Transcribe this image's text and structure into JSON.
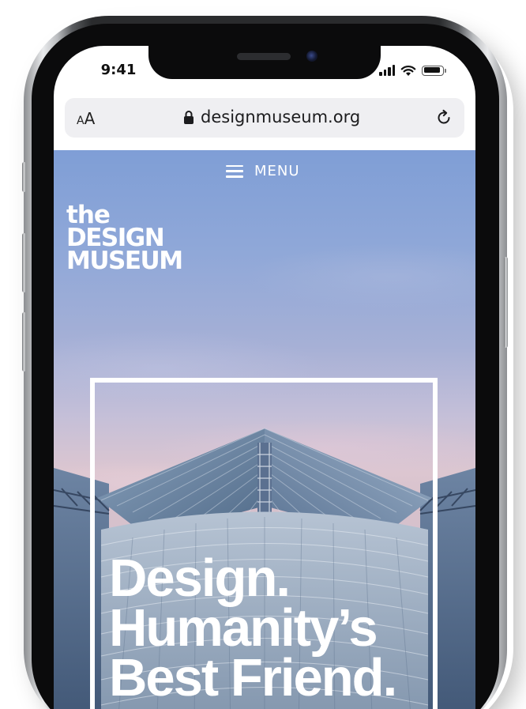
{
  "status_bar": {
    "time": "9:41",
    "icons": [
      "signal-icon",
      "wifi-icon",
      "battery-icon"
    ]
  },
  "browser": {
    "text_size_small": "A",
    "text_size_big": "A",
    "url": "designmuseum.org",
    "lock_icon": "lock-icon",
    "reload_icon": "reload-icon"
  },
  "site": {
    "menu_label": "MENU",
    "logo_lines": [
      "the",
      "DESIGN",
      "MUSEUM"
    ],
    "headline_lines": [
      "Design.",
      "Humanity’s",
      "Best Friend."
    ]
  },
  "colors": {
    "sky_top": "#7f9ed6",
    "sky_bottom": "#dcc6d0",
    "text_on_image": "#ffffff",
    "address_bar_bg": "#efeff2"
  }
}
